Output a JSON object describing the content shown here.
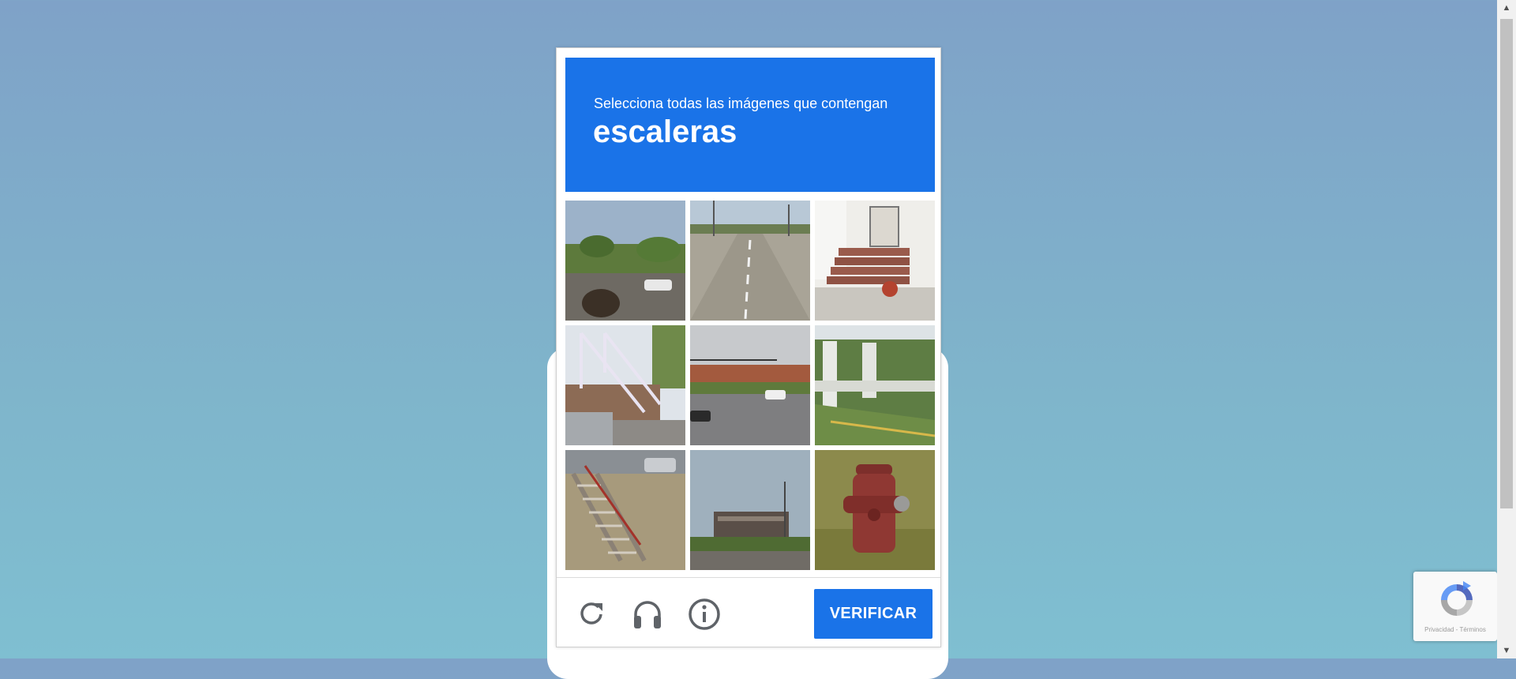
{
  "challenge": {
    "prompt": "Selecciona todas las imágenes que contengan",
    "keyword": "escaleras",
    "accent_color": "#1a73e8",
    "tiles": [
      {
        "name": "tile-street-trees",
        "icon": "street-scene"
      },
      {
        "name": "tile-road",
        "icon": "road"
      },
      {
        "name": "tile-porch-steps",
        "icon": "stairs"
      },
      {
        "name": "tile-white-stairs",
        "icon": "stairs"
      },
      {
        "name": "tile-intersection",
        "icon": "intersection"
      },
      {
        "name": "tile-overpass",
        "icon": "bridge"
      },
      {
        "name": "tile-outdoor-stairs",
        "icon": "stairs"
      },
      {
        "name": "tile-building-lot",
        "icon": "building"
      },
      {
        "name": "tile-fire-hydrant",
        "icon": "fire-hydrant"
      }
    ]
  },
  "footer": {
    "reload_icon": "reload-icon",
    "audio_icon": "headphones-icon",
    "info_icon": "info-icon",
    "verify_label": "VERIFICAR"
  },
  "badge": {
    "privacy_label": "Privacidad",
    "separator": " - ",
    "terms_label": "Términos"
  }
}
